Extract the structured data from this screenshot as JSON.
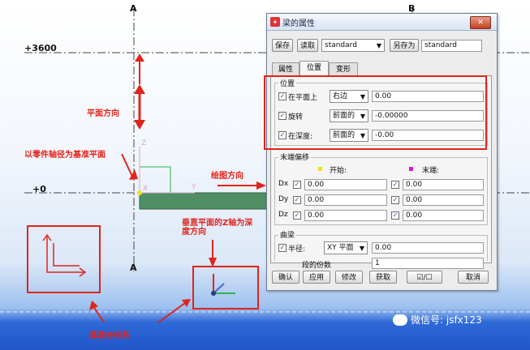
{
  "viewport": {
    "grid_labels": {
      "a_top": "A",
      "b_top": "B",
      "a_bottom": "A"
    },
    "elevations": {
      "upper": "+3600",
      "lower": "+0"
    },
    "axis_letters": {
      "z_small": "Z",
      "x_small": "X",
      "y_small": "Y"
    },
    "annotations": {
      "up_direction": "平面方向",
      "part_axis_base": "以零件轴径为基准平面",
      "draw_direction": "绘图方向",
      "z_depth": "垂直平面的Z轴为深度方向",
      "base_coords": "基准坐标系"
    },
    "watermark": "微信号: jsfx123",
    "colors": {
      "annotation": "#e0241c",
      "beam": "#4f8f63"
    }
  },
  "dialog": {
    "title": "梁的属性",
    "toolbar": {
      "save": "保存",
      "load": "读取",
      "preset": "standard",
      "save_as": "另存为",
      "save_as_value": "standard"
    },
    "tabs": [
      "属性",
      "位置",
      "变形"
    ],
    "active_tab": "位置",
    "position": {
      "group_label": "位置",
      "rows": [
        {
          "label": "在平面上",
          "option": "右边",
          "value": "0.00",
          "checked": true
        },
        {
          "label": "旋转",
          "option": "前面的",
          "value": "-0.00000",
          "checked": true
        },
        {
          "label": "在深度:",
          "option": "前面的",
          "value": "-0.00",
          "checked": true
        }
      ]
    },
    "end_offset": {
      "group_label": "末端偏移",
      "start_label": "开始:",
      "end_label": "末端:",
      "start_color": "#f4e400",
      "end_color": "#d41bd4",
      "rows": [
        {
          "label": "Dx",
          "start": "0.00",
          "end": "0.00"
        },
        {
          "label": "Dy",
          "start": "0.00",
          "end": "0.00"
        },
        {
          "label": "Dz",
          "start": "0.00",
          "end": "0.00"
        }
      ]
    },
    "curve": {
      "group_label": "曲梁",
      "radius_label": "半径:",
      "plane": "XY 平面",
      "radius": "0.00",
      "segments_label": "段的份数",
      "segments": "1"
    },
    "footer": {
      "ok": "确认",
      "apply": "应用",
      "modify": "修改",
      "get": "获取",
      "toggle": "☑/☐",
      "cancel": "取消"
    }
  }
}
